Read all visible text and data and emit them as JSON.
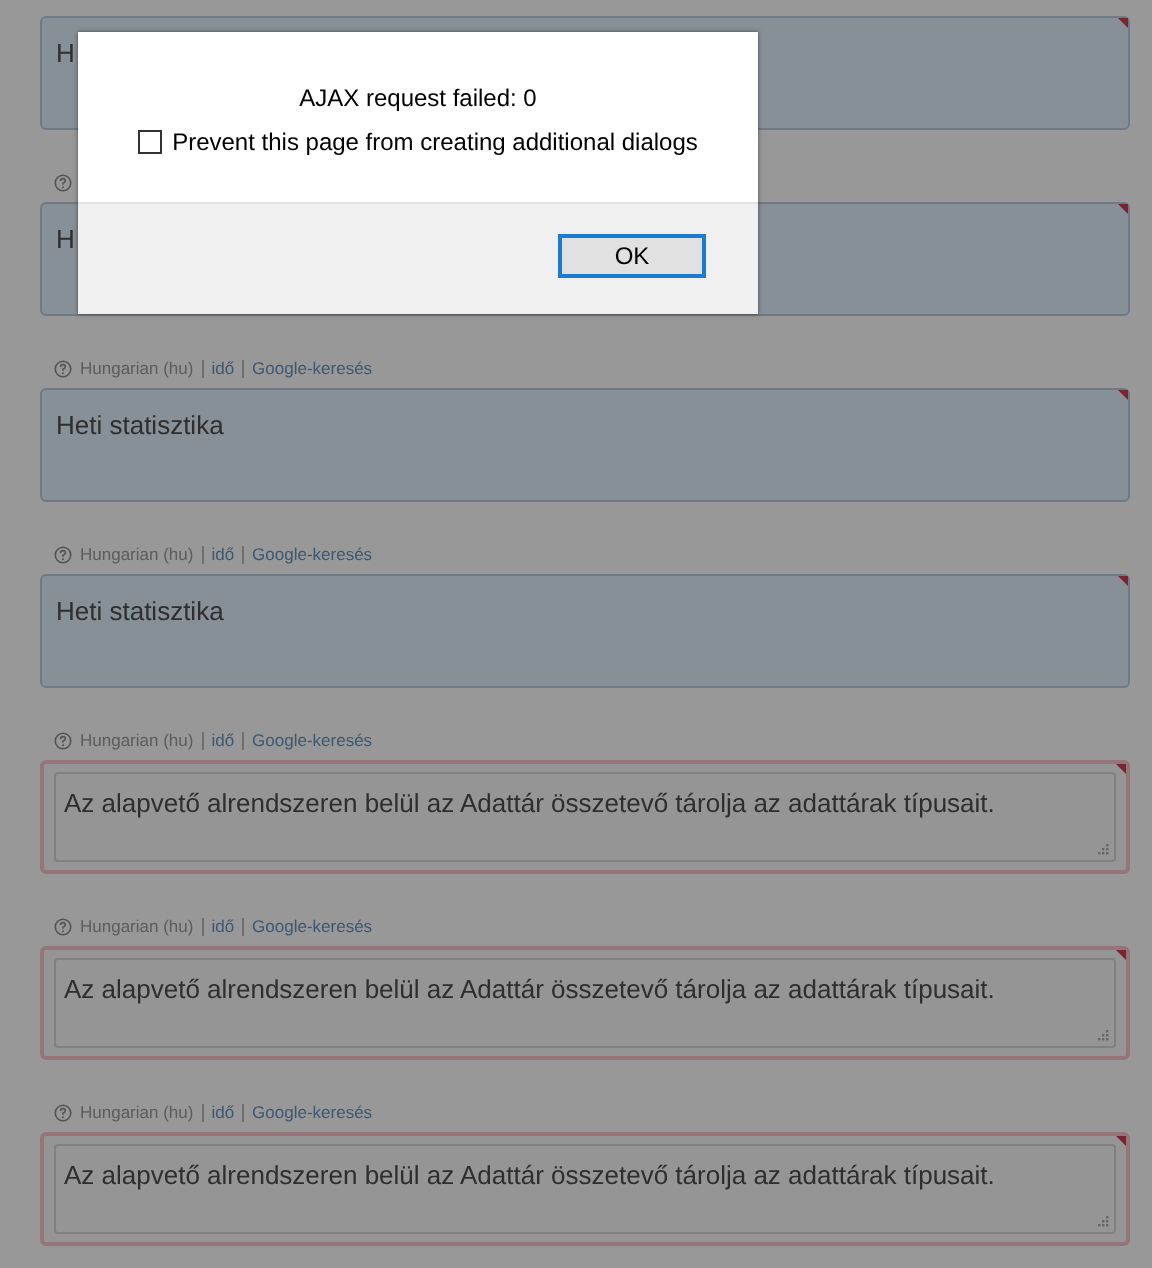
{
  "entries": [
    {
      "kind": "input",
      "value": "H"
    },
    {
      "kind": "input",
      "meta": {
        "help": true
      },
      "value": "H"
    },
    {
      "kind": "input",
      "meta": {
        "help": true,
        "language": "Hungarian (hu)",
        "links": [
          "idő",
          "Google-keresés"
        ]
      },
      "value": "Heti statisztika"
    },
    {
      "kind": "input",
      "meta": {
        "help": true,
        "language": "Hungarian (hu)",
        "links": [
          "idő",
          "Google-keresés"
        ]
      },
      "value": "Heti statisztika"
    },
    {
      "kind": "textarea",
      "meta": {
        "help": true,
        "language": "Hungarian (hu)",
        "links": [
          "idő",
          "Google-keresés"
        ]
      },
      "value": "Az alapvető alrendszeren belül az Adattár összetevő tárolja az adattárak típusait."
    },
    {
      "kind": "textarea",
      "meta": {
        "help": true,
        "language": "Hungarian (hu)",
        "links": [
          "idő",
          "Google-keresés"
        ]
      },
      "value": "Az alapvető alrendszeren belül az Adattár összetevő tárolja az adattárak típusait."
    },
    {
      "kind": "textarea",
      "meta": {
        "help": true,
        "language": "Hungarian (hu)",
        "links": [
          "idő",
          "Google-keresés"
        ]
      },
      "value": "Az alapvető alrendszeren belül az Adattár összetevő tárolja az adattárak típusait."
    }
  ],
  "dialog": {
    "message": "AJAX request failed: 0",
    "checkbox": {
      "label": "Prevent this page from creating additional dialogs",
      "checked": false
    },
    "buttons": [
      "OK"
    ]
  }
}
